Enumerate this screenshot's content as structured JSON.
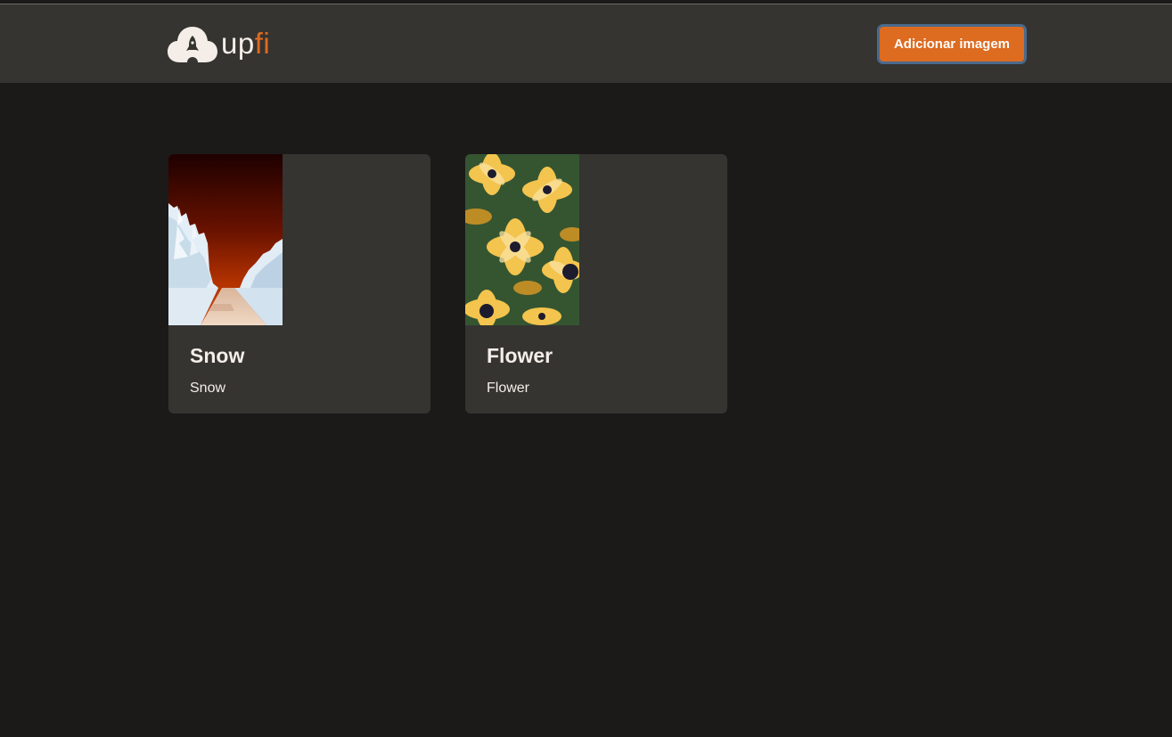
{
  "header": {
    "logo_text_1": "up",
    "logo_text_2": "fi",
    "add_button_label": "Adicionar imagem"
  },
  "cards": [
    {
      "title": "Snow",
      "description": "Snow",
      "image_icon": "snowy-forest-road-photo"
    },
    {
      "title": "Flower",
      "description": "Flower",
      "image_icon": "yellow-flowers-photo"
    }
  ],
  "colors": {
    "background": "#1b1a19",
    "header": "#353431",
    "card": "#353431",
    "accent": "#dd6b20",
    "text": "#f4ede8"
  }
}
